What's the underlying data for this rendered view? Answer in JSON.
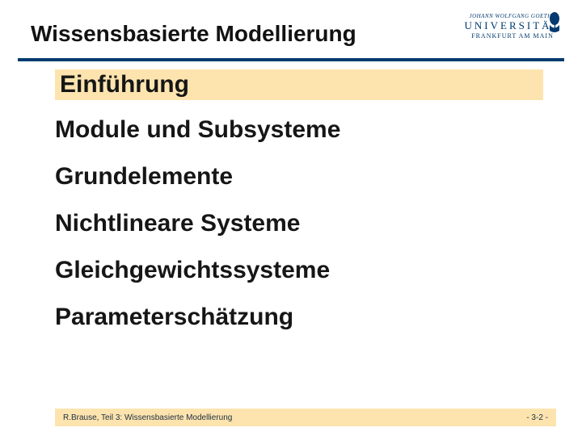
{
  "header": {
    "title": "Wissensbasierte Modellierung",
    "logo": {
      "goethe": "JOHANN WOLFGANG GOETHE",
      "univ": "UNIVERSITÄT",
      "frank": "FRANKFURT AM MAIN"
    }
  },
  "items": [
    "Einführung",
    "Module und Subsysteme",
    "Grundelemente",
    "Nichtlineare Systeme",
    "Gleichgewichtssysteme",
    "Parameterschätzung"
  ],
  "footer": {
    "left": "R.Brause, Teil 3: Wissensbasierte Modellierung",
    "right": "- 3-2 -"
  }
}
